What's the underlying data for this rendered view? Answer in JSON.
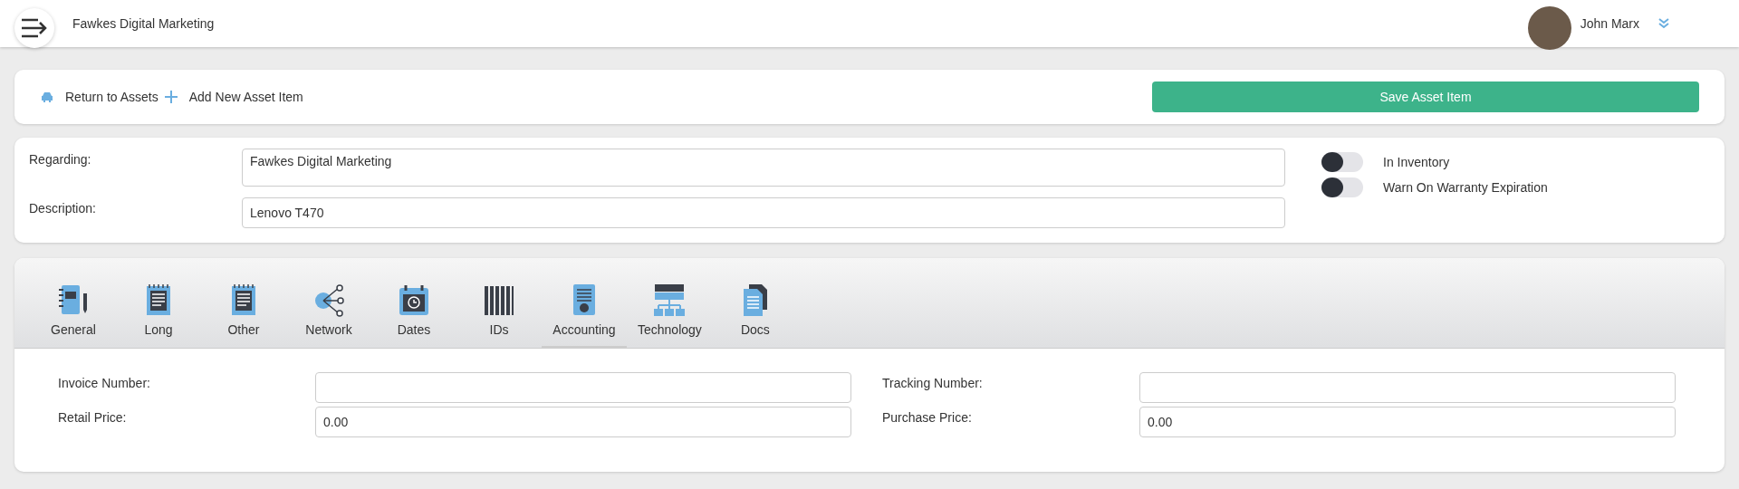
{
  "header": {
    "company": "Fawkes Digital Marketing",
    "user": "John Marx"
  },
  "toolbar": {
    "links": [
      {
        "label": "Return to Assets",
        "kind": "car"
      },
      {
        "label": "Add New Asset Item",
        "kind": "plus"
      }
    ],
    "save_button": "Save Asset Item"
  },
  "details": {
    "fields": [
      {
        "label": "Regarding:",
        "value": "Fawkes Digital Marketing",
        "kind": "tall"
      },
      {
        "label": "Description:",
        "value": "Lenovo T470",
        "kind": "short"
      }
    ],
    "toggles": [
      {
        "label": "In Inventory",
        "on": false
      },
      {
        "label": "Warn On Warranty Expiration",
        "on": false
      }
    ]
  },
  "tabs": [
    {
      "label": "General",
      "kind": "notebook",
      "selected": false
    },
    {
      "label": "Long",
      "kind": "notepad",
      "selected": false
    },
    {
      "label": "Other",
      "kind": "notepad",
      "selected": false
    },
    {
      "label": "Network",
      "kind": "share",
      "selected": false
    },
    {
      "label": "Dates",
      "kind": "calendar",
      "selected": false
    },
    {
      "label": "IDs",
      "kind": "barcode",
      "selected": false
    },
    {
      "label": "Accounting",
      "kind": "invoice",
      "selected": true
    },
    {
      "label": "Technology",
      "kind": "server",
      "selected": false
    },
    {
      "label": "Docs",
      "kind": "docs",
      "selected": false
    }
  ],
  "accounting": {
    "fields": [
      {
        "label": "Invoice Number:"
      },
      {
        "label": "Tracking Number:"
      },
      {
        "label": "Retail Price:",
        "value": "0.00"
      },
      {
        "label": "Purchase Price:",
        "value": "0.00"
      }
    ]
  }
}
